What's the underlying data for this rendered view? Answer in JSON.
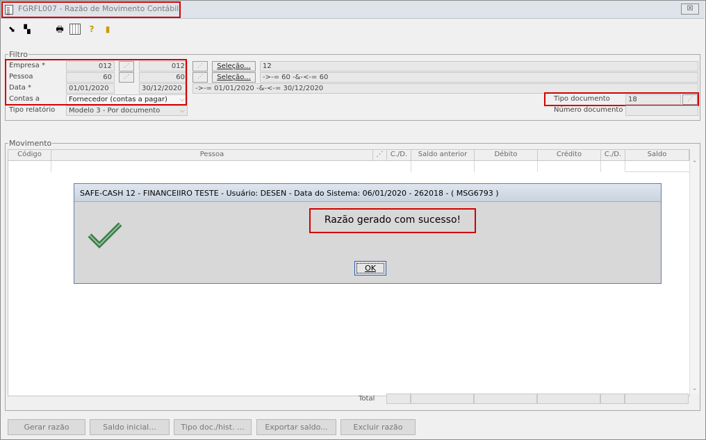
{
  "window": {
    "title": "FGRFL007 - Razão de Movimento Contábil",
    "close_label": "☒"
  },
  "toolbar": {
    "icons": [
      "arrow-in-icon",
      "copy-icon",
      "print-icon",
      "calendar-icon",
      "help-icon",
      "exit-icon"
    ]
  },
  "filtro": {
    "label": "Filtro",
    "empresa": {
      "label": "Empresa *",
      "from": "012",
      "to": "012",
      "selecao": "Seleção...",
      "summary": "12"
    },
    "pessoa": {
      "label": "Pessoa",
      "from": "60",
      "to": "60",
      "selecao": "Seleção...",
      "summary": "->-= 60 -&-<-= 60"
    },
    "data": {
      "label": "Data *",
      "from": "01/01/2020",
      "to": "30/12/2020",
      "summary": "->-= 01/01/2020 -&-<-= 30/12/2020"
    },
    "contas": {
      "label": "Contas a",
      "value": "Fornecedor (contas a pagar)"
    },
    "tipo_relatorio": {
      "label": "Tipo relatório",
      "value": "Modelo 3 - Por documento"
    },
    "tipo_documento": {
      "label": "Tipo documento",
      "value": "18"
    },
    "numero_documento": {
      "label": "Número documento",
      "value": ""
    }
  },
  "movimento": {
    "label": "Movimento",
    "columns": [
      "Código",
      "Pessoa",
      "C./D.",
      "Saldo anterior",
      "Débito",
      "Crédito",
      "C./D.",
      "Saldo"
    ],
    "total_label": "Total"
  },
  "dialog": {
    "title": "SAFE-CASH 12 - FINANCEIIRO TESTE - Usuário: DESEN - Data do Sistema: 06/01/2020 - 262018 - ( MSG6793 )",
    "message": "Razão gerado com sucesso!",
    "ok_label": "OK"
  },
  "actions": {
    "gerar": "Gerar razão",
    "saldo_inicial": "Saldo inicial...",
    "tipo_doc": "Tipo doc./hist. ...",
    "exportar": "Exportar saldo...",
    "excluir": "Excluir razão"
  },
  "colors": {
    "highlight": "#d10000",
    "check": "#3f7a4a"
  }
}
